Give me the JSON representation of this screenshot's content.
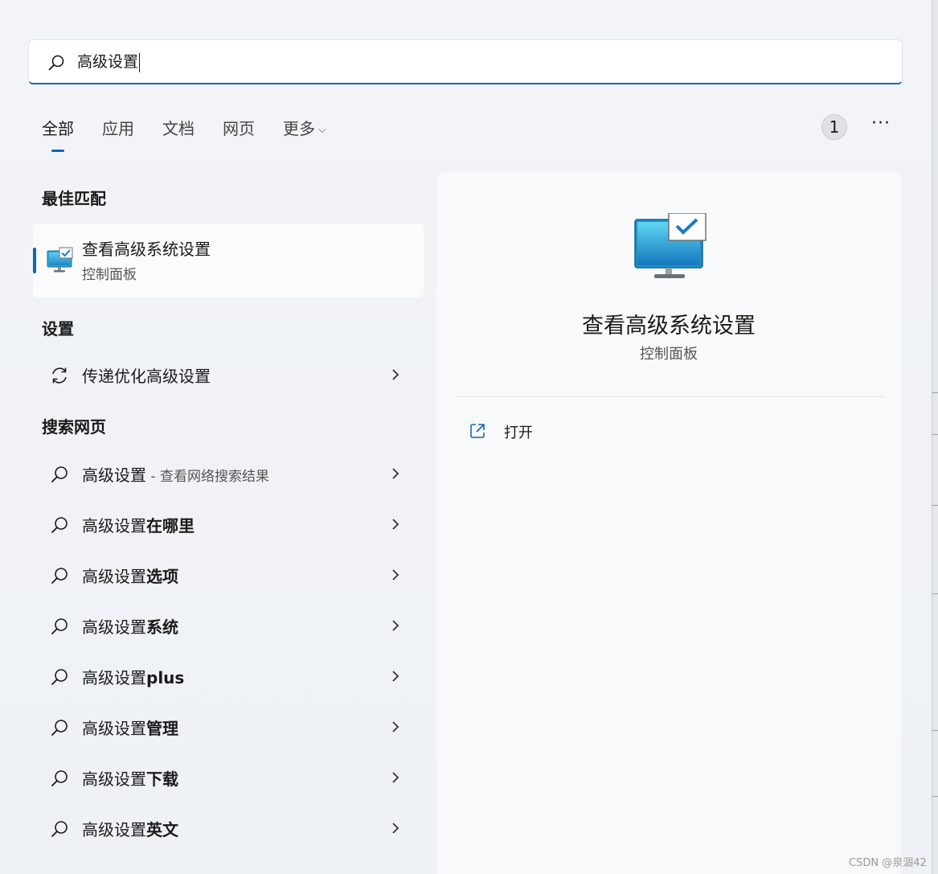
{
  "search": {
    "query": "高级设置"
  },
  "tabs": [
    {
      "label": "全部"
    },
    {
      "label": "应用"
    },
    {
      "label": "文档"
    },
    {
      "label": "网页"
    },
    {
      "label": "更多"
    }
  ],
  "badge": {
    "count": "1"
  },
  "more_button": {
    "label": "···"
  },
  "sections": {
    "best_match": "最佳匹配",
    "settings": "设置",
    "web": "搜索网页"
  },
  "best_match": {
    "title": "查看高级系统设置",
    "subtitle": "控制面板",
    "icon": "monitor-check-icon"
  },
  "settings_items": [
    {
      "label": "传递优化高级设置",
      "icon": "refresh-icon"
    }
  ],
  "web_items": [
    {
      "prefix": "高级设置",
      "suffix": "",
      "hint": " - 查看网络搜索结果"
    },
    {
      "prefix": "高级设置",
      "suffix": "在哪里",
      "hint": ""
    },
    {
      "prefix": "高级设置",
      "suffix": "选项",
      "hint": ""
    },
    {
      "prefix": "高级设置",
      "suffix": "系统",
      "hint": ""
    },
    {
      "prefix": "高级设置",
      "suffix": "plus",
      "hint": ""
    },
    {
      "prefix": "高级设置",
      "suffix": "管理",
      "hint": ""
    },
    {
      "prefix": "高级设置",
      "suffix": "下载",
      "hint": ""
    },
    {
      "prefix": "高级设置",
      "suffix": "英文",
      "hint": ""
    }
  ],
  "preview": {
    "title": "查看高级系统设置",
    "subtitle": "控制面板",
    "actions": [
      {
        "label": "打开",
        "icon": "open-external-icon"
      }
    ]
  },
  "watermark": "CSDN @泉涸42",
  "colors": {
    "accent": "#0f66b8"
  }
}
